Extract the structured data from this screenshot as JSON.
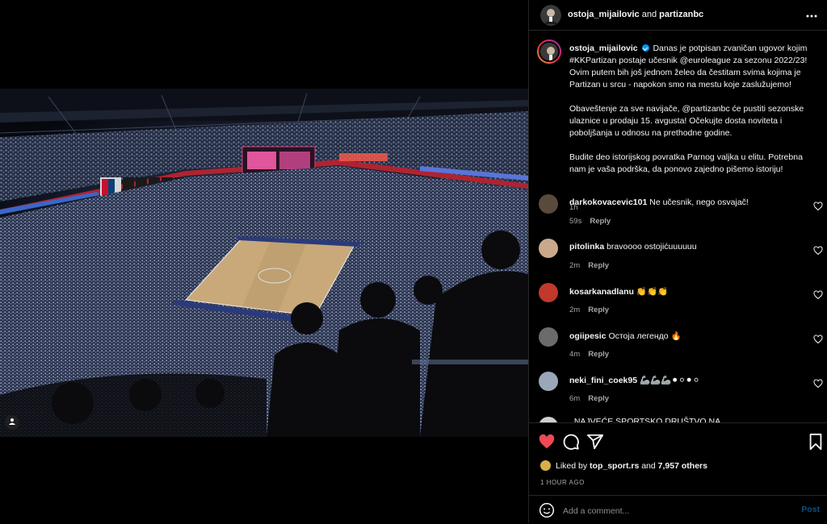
{
  "header": {
    "user1": "ostoja_mijailovic",
    "and_text": "and",
    "user2": "partizanbc"
  },
  "caption": {
    "username": "ostoja_mijailovic",
    "p1": "Danas je potpisan zvaničan ugovor kojim #KKPartizan postaje učesnik @euroleague za sezonu 2022/23! Ovim putem bih još jednom želeo da čestitam svima kojima je Partizan u srcu - napokon smo na mestu koje zaslužujemo!",
    "p2": "Obaveštenje za sve navijače, @partizanbc će pustiti sezonske ulaznice u prodaju 15. avgusta! Očekujte dosta noviteta i poboljšanja u odnosu na prethodne godine.",
    "p3": "Budite deo istorijskog povratka Parnog valjka u elitu. Potrebna nam je vaša podrška, da ponovo zajedno pišemo istoriju!",
    "time": "1h"
  },
  "comments": [
    {
      "user": "darkokovacevic101",
      "text": "Ne učesnik, nego osvajač!",
      "time": "59s",
      "reply": "Reply",
      "avatar_color": "#5a4a3c"
    },
    {
      "user": "pitolinka",
      "text": "bravoooo ostojićuuuuuu",
      "time": "2m",
      "reply": "Reply",
      "avatar_color": "#c9a98a"
    },
    {
      "user": "kosarkanadlanu",
      "text": "👏👏👏",
      "time": "2m",
      "reply": "Reply",
      "avatar_color": "#c0392b"
    },
    {
      "user": "ogiipesic",
      "text": "Остоја легендо 🔥",
      "time": "4m",
      "reply": "Reply",
      "avatar_color": "#6b6b6b"
    },
    {
      "user": "neki_fini_coek95",
      "text": "🦾🦾🦾⚫⚪⚫⚪",
      "time": "6m",
      "reply": "Reply",
      "avatar_color": "#9aa7b8"
    }
  ],
  "cut_comment": "  NAJVEĆE SPORTSKO DRUŠTVO NA",
  "likes": {
    "prefix": "Liked by",
    "user": "top_sport.rs",
    "and_text": "and",
    "others": "7,957 others"
  },
  "posted_ago": "1 HOUR AGO",
  "add_comment": {
    "placeholder": "Add a comment...",
    "post_label": "Post"
  },
  "colors": {
    "like_red": "#ed4956",
    "link_blue": "#0095f6",
    "post_disabled": "#0d5180"
  },
  "icons": [
    "more-icon",
    "heart-icon",
    "comment-icon",
    "share-icon",
    "bookmark-icon",
    "emoji-icon",
    "tag-user-icon",
    "verified-icon"
  ]
}
